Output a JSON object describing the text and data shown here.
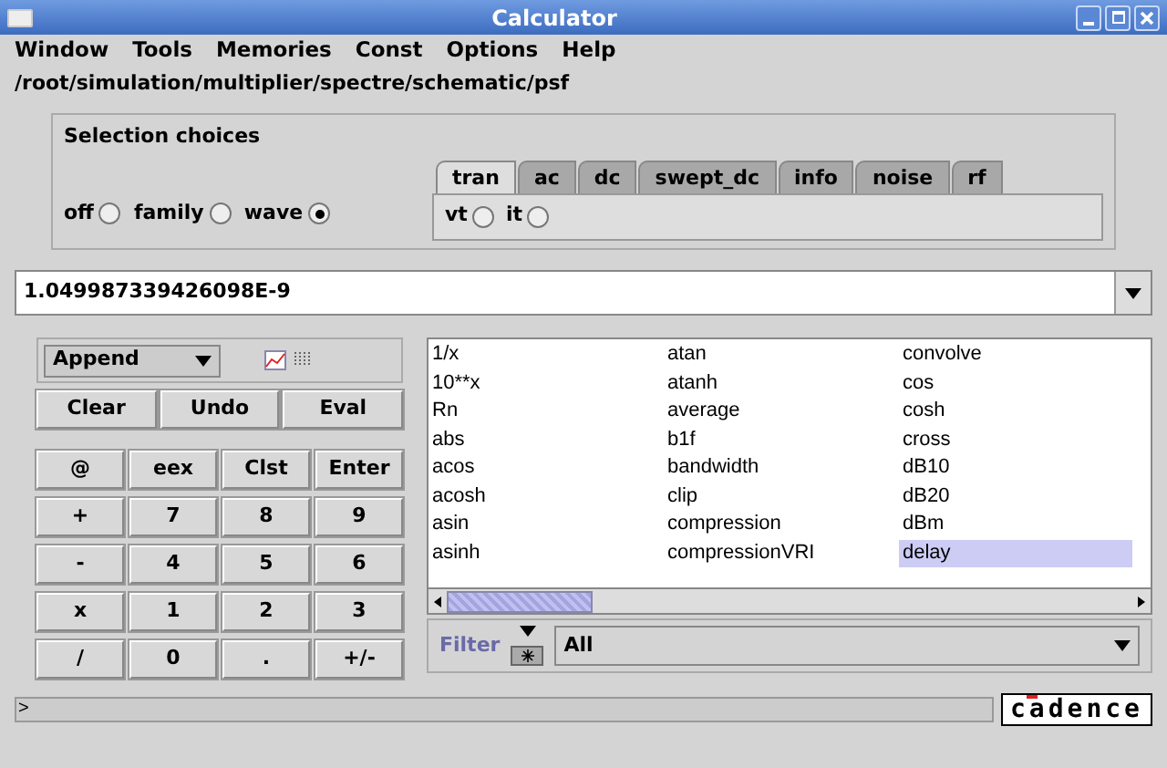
{
  "window": {
    "title": "Calculator"
  },
  "menu": [
    "Window",
    "Tools",
    "Memories",
    "Const",
    "Options",
    "Help"
  ],
  "path": "/root/simulation/multiplier/spectre/schematic/psf",
  "selection_choices": {
    "title": "Selection choices",
    "modes": [
      {
        "label": "off",
        "selected": false
      },
      {
        "label": "family",
        "selected": false
      },
      {
        "label": "wave",
        "selected": true
      }
    ],
    "tabs": [
      {
        "label": "tran",
        "selected": true
      },
      {
        "label": "ac",
        "selected": false
      },
      {
        "label": "dc",
        "selected": false
      },
      {
        "label": "swept_dc",
        "selected": false
      },
      {
        "label": "info",
        "selected": false
      },
      {
        "label": "noise",
        "selected": false
      },
      {
        "label": "rf",
        "selected": false
      }
    ],
    "signals": [
      {
        "label": "vt",
        "selected": false
      },
      {
        "label": "it",
        "selected": false
      }
    ]
  },
  "value_field": {
    "value": "1.049987339426098E-9"
  },
  "keypad": {
    "mode": "Append",
    "actions": [
      "Clear",
      "Undo",
      "Eval"
    ],
    "keys": [
      "@",
      "eex",
      "Clst",
      "Enter",
      "+",
      "7",
      "8",
      "9",
      "-",
      "4",
      "5",
      "6",
      "x",
      "1",
      "2",
      "3",
      "/",
      "0",
      ".",
      "+/-"
    ]
  },
  "functions": {
    "columns": [
      {
        "items": [
          {
            "label": "1/x",
            "selected": false
          },
          {
            "label": "10**x",
            "selected": false
          },
          {
            "label": "Rn",
            "selected": false
          },
          {
            "label": "abs",
            "selected": false
          },
          {
            "label": "acos",
            "selected": false
          },
          {
            "label": "acosh",
            "selected": false
          },
          {
            "label": "asin",
            "selected": false
          },
          {
            "label": "asinh",
            "selected": false
          }
        ]
      },
      {
        "items": [
          {
            "label": "atan",
            "selected": false
          },
          {
            "label": "atanh",
            "selected": false
          },
          {
            "label": "average",
            "selected": false
          },
          {
            "label": "b1f",
            "selected": false
          },
          {
            "label": "bandwidth",
            "selected": false
          },
          {
            "label": "clip",
            "selected": false
          },
          {
            "label": "compression",
            "selected": false
          },
          {
            "label": "compressionVRI",
            "selected": false
          }
        ]
      },
      {
        "items": [
          {
            "label": "convolve",
            "selected": false
          },
          {
            "label": "cos",
            "selected": false
          },
          {
            "label": "cosh",
            "selected": false
          },
          {
            "label": "cross",
            "selected": false
          },
          {
            "label": "dB10",
            "selected": false
          },
          {
            "label": "dB20",
            "selected": false
          },
          {
            "label": "dBm",
            "selected": false
          },
          {
            "label": "delay",
            "selected": true
          }
        ]
      }
    ]
  },
  "filter": {
    "label": "Filter",
    "value": "All"
  },
  "status": {
    "prompt": ">"
  },
  "logo": "cadence"
}
